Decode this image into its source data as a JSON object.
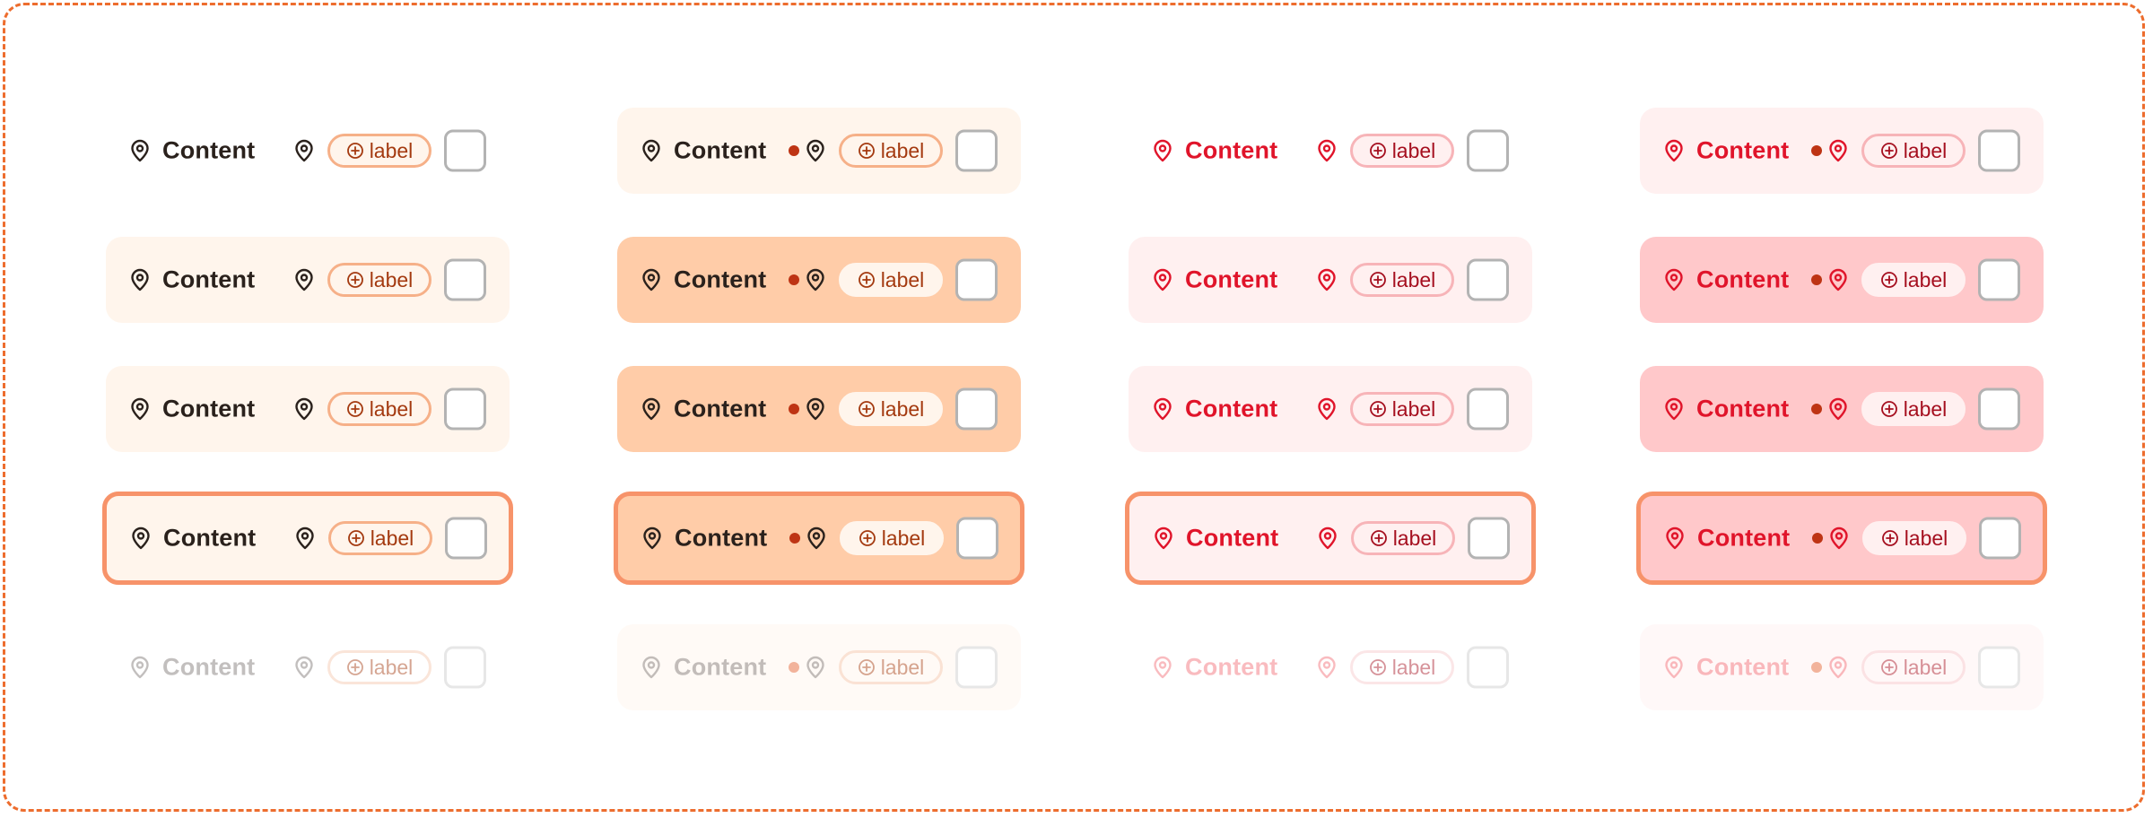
{
  "text": "Content",
  "badge_label": "label",
  "icons": {
    "pin": "map-pin-icon",
    "badge": "plus-circle-icon",
    "dot": "dot-indicator"
  },
  "colors": {
    "frame_border": "#ed6d2e",
    "selected_border": "#f7936a",
    "orange_bg_light": "#fff5ec",
    "orange_bg_strong": "#ffcca8",
    "red_bg_light": "#fff0f0",
    "red_bg_strong": "#ffc8ca",
    "text_dark": "#2a211c",
    "text_red": "#e0142a"
  },
  "columns": [
    {
      "tone": "orange",
      "dot": false,
      "states": [
        {
          "state": "default",
          "bg": "transparent",
          "badge_bg": "#fff5ec",
          "badge_border": "#f6b088"
        },
        {
          "state": "hover",
          "bg": "#fff5ec",
          "badge_bg": "#fff5ec",
          "badge_border": "#f6b088"
        },
        {
          "state": "active",
          "bg": "#fff5ec",
          "badge_bg": "#fff5ec",
          "badge_border": "#f6b088"
        },
        {
          "state": "selected",
          "bg": "#fff5ec",
          "badge_bg": "#fff5ec",
          "badge_border": "#f6b088"
        },
        {
          "state": "disabled",
          "bg": "transparent",
          "badge_bg": "#ffffff",
          "badge_border": "#f4c7ad"
        }
      ]
    },
    {
      "tone": "orange",
      "dot": true,
      "states": [
        {
          "state": "default",
          "bg": "#fff5ec",
          "badge_bg": "#fff5ec",
          "badge_border": "#f6b088"
        },
        {
          "state": "hover",
          "bg": "#ffcca8",
          "badge_bg": "#fff5ec",
          "badge_border": "#fff5ec"
        },
        {
          "state": "active",
          "bg": "#ffcca8",
          "badge_bg": "#fff5ec",
          "badge_border": "#fff5ec"
        },
        {
          "state": "selected",
          "bg": "#ffcca8",
          "badge_bg": "#fff5ec",
          "badge_border": "#fff5ec"
        },
        {
          "state": "disabled",
          "bg": "#fffaf6",
          "badge_bg": "#fffaf6",
          "badge_border": "#f4c7ad"
        }
      ]
    },
    {
      "tone": "red",
      "dot": false,
      "states": [
        {
          "state": "default",
          "bg": "transparent",
          "badge_bg": "#fff0f0",
          "badge_border": "#f7b4b8"
        },
        {
          "state": "hover",
          "bg": "#fff0f0",
          "badge_bg": "#fff0f0",
          "badge_border": "#f7b4b8"
        },
        {
          "state": "active",
          "bg": "#fff0f0",
          "badge_bg": "#fff0f0",
          "badge_border": "#f7b4b8"
        },
        {
          "state": "selected",
          "bg": "#fff0f0",
          "badge_bg": "#fff0f0",
          "badge_border": "#f7b4b8"
        },
        {
          "state": "disabled",
          "bg": "transparent",
          "badge_bg": "#ffffff",
          "badge_border": "#f7c9cc"
        }
      ]
    },
    {
      "tone": "red",
      "dot": true,
      "states": [
        {
          "state": "default",
          "bg": "#fff0f0",
          "badge_bg": "#fff0f0",
          "badge_border": "#f7b4b8"
        },
        {
          "state": "hover",
          "bg": "#ffc8ca",
          "badge_bg": "#fff0f0",
          "badge_border": "#fff0f0"
        },
        {
          "state": "active",
          "bg": "#ffc8ca",
          "badge_bg": "#fff0f0",
          "badge_border": "#fff0f0"
        },
        {
          "state": "selected",
          "bg": "#ffc8ca",
          "badge_bg": "#fff0f0",
          "badge_border": "#fff0f0"
        },
        {
          "state": "disabled",
          "bg": "#fff8f8",
          "badge_bg": "#fff8f8",
          "badge_border": "#f7c9cc"
        }
      ]
    }
  ]
}
